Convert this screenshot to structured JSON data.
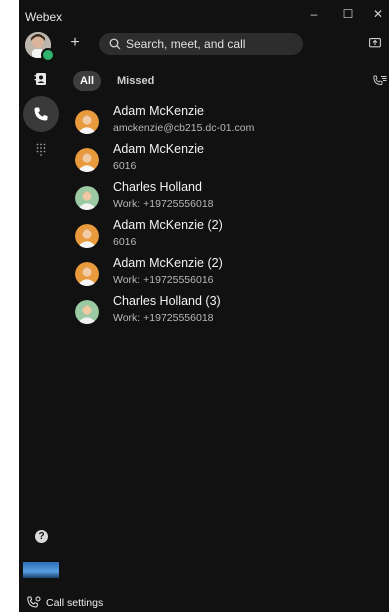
{
  "app": {
    "title": "Webex"
  },
  "window_controls": {
    "minimize": "–",
    "maximize": "☐",
    "close": "✕"
  },
  "header": {
    "add_symbol": "+",
    "search_placeholder": "Search, meet, and call"
  },
  "tabs": [
    {
      "label": "All",
      "selected": true
    },
    {
      "label": "Missed",
      "selected": false
    }
  ],
  "calls": [
    {
      "name": "Adam McKenzie",
      "detail": "amckenzie@cb215.dc-01.com",
      "avatar": "adam"
    },
    {
      "name": "Adam McKenzie",
      "detail": "6016",
      "avatar": "adam"
    },
    {
      "name": "Charles Holland",
      "detail": "Work: +19725556018",
      "avatar": "charles"
    },
    {
      "name": "Adam McKenzie (2)",
      "detail": "6016",
      "avatar": "adam"
    },
    {
      "name": "Adam McKenzie (2)",
      "detail": "Work: +19725556016",
      "avatar": "adam"
    },
    {
      "name": "Charles Holland (3)",
      "detail": "Work: +19725556018",
      "avatar": "charles"
    }
  ],
  "footer": {
    "help": "?",
    "call_settings": "Call settings"
  },
  "icons": {
    "contacts": "contacts-icon",
    "calls": "phone-icon",
    "dialpad": "dialpad-icon",
    "search": "search-icon",
    "share": "screen-share-icon",
    "filter": "call-filter-icon"
  },
  "colors": {
    "window_bg": "#111111",
    "presence": "#2fb26c",
    "selected_tab": "#3d3d3d"
  }
}
